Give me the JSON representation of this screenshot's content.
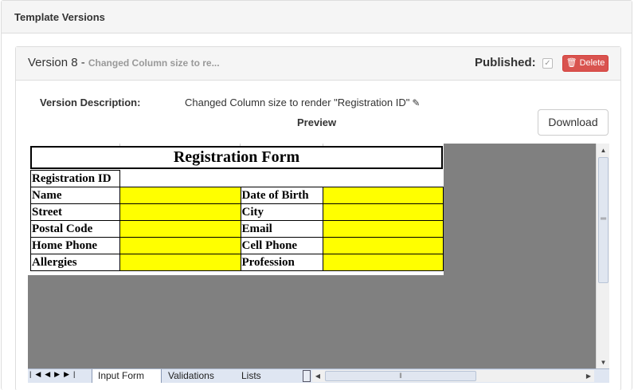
{
  "panel": {
    "title": "Template Versions"
  },
  "version": {
    "title": "Version 8",
    "separator": " - ",
    "subtitle": "Changed Column size to re...",
    "published_label": "Published:",
    "published_checked": true,
    "delete_label": "Delete",
    "delete_color": "#d9534f"
  },
  "details": {
    "description_label": "Version Description:",
    "description_value": "Changed Column size to render \"Registration ID\"",
    "preview_label": "Preview",
    "download_label": "Download"
  },
  "form": {
    "title": "Registration Form",
    "registration_id_label": "Registration ID",
    "rows": [
      {
        "left": "Name",
        "right": "Date of Birth"
      },
      {
        "left": "Street",
        "right": "City"
      },
      {
        "left": "Postal Code",
        "right": "Email"
      },
      {
        "left": "Home Phone",
        "right": "Cell Phone"
      },
      {
        "left": "Allergies",
        "right": "Profession"
      }
    ],
    "highlight_color": "#ffff00"
  },
  "sheet_tabs": [
    "Input Form",
    "Validations",
    "Lists"
  ],
  "colors": {
    "sheet_background": "#808080",
    "tab_bar": "#dfe6f2"
  }
}
